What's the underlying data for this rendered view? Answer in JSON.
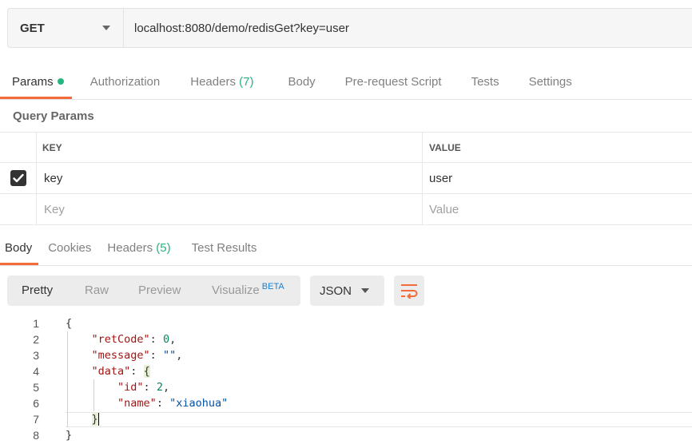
{
  "request": {
    "method": "GET",
    "url": "localhost:8080/demo/redisGet?key=user"
  },
  "request_tabs": [
    {
      "label": "Params",
      "active": true,
      "indicator": "green-dot"
    },
    {
      "label": "Authorization"
    },
    {
      "label": "Headers",
      "count": "(7)"
    },
    {
      "label": "Body"
    },
    {
      "label": "Pre-request Script"
    },
    {
      "label": "Tests"
    },
    {
      "label": "Settings"
    }
  ],
  "query_params": {
    "title": "Query Params",
    "columns": {
      "key": "KEY",
      "value": "VALUE"
    },
    "rows": [
      {
        "checked": true,
        "key": "key",
        "value": "user"
      }
    ],
    "placeholder": {
      "key": "Key",
      "value": "Value"
    }
  },
  "response_tabs": [
    {
      "label": "Body",
      "active": true
    },
    {
      "label": "Cookies"
    },
    {
      "label": "Headers",
      "count": "(5)"
    },
    {
      "label": "Test Results"
    }
  ],
  "format": {
    "modes": [
      "Pretty",
      "Raw",
      "Preview",
      "Visualize"
    ],
    "active": "Pretty",
    "beta_label": "BETA",
    "language": "JSON"
  },
  "code_lines": [
    {
      "num": "1"
    },
    {
      "num": "2"
    },
    {
      "num": "3"
    },
    {
      "num": "4"
    },
    {
      "num": "5"
    },
    {
      "num": "6"
    },
    {
      "num": "7"
    },
    {
      "num": "8"
    }
  ],
  "response_json": {
    "retCode_key": "\"retCode\"",
    "retCode_val": "0",
    "message_key": "\"message\"",
    "message_val": "\"\"",
    "data_key": "\"data\"",
    "id_key": "\"id\"",
    "id_val": "2",
    "name_key": "\"name\"",
    "name_val": "\"xiaohua\""
  },
  "colors": {
    "accent": "#f26b3a",
    "success": "#26b47f",
    "beta": "#1a7fd4"
  }
}
